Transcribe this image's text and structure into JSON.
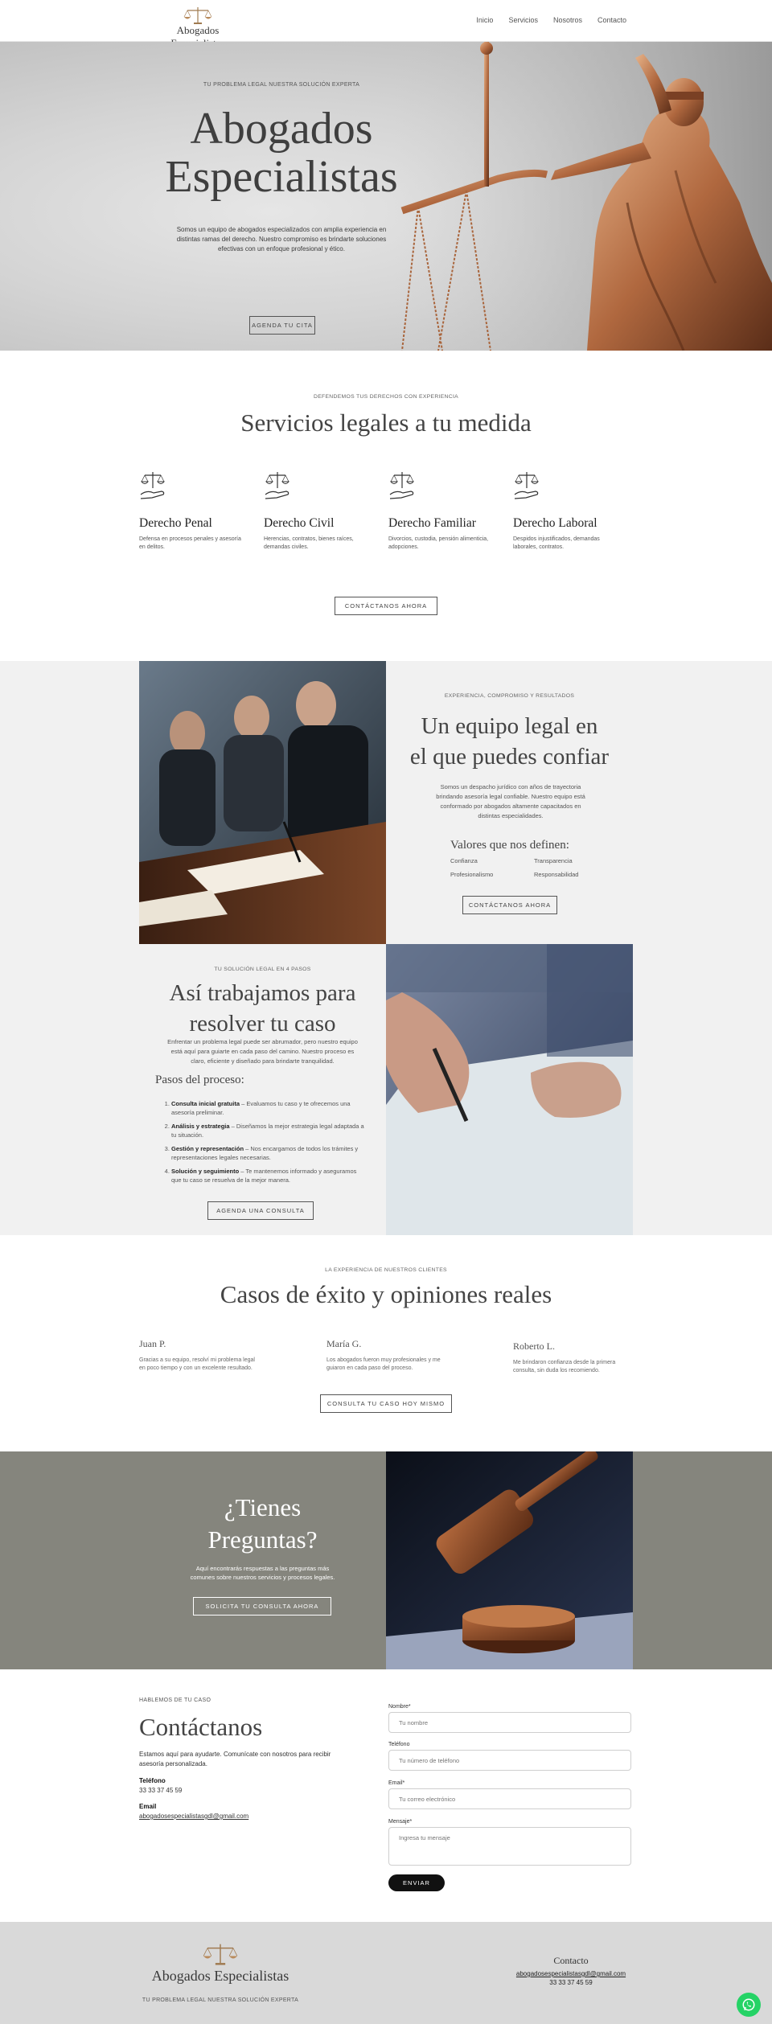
{
  "header": {
    "logo_text": "Abogados Especialistas",
    "nav": [
      "Inicio",
      "Servicios",
      "Nosotros",
      "Contacto"
    ]
  },
  "hero": {
    "kicker": "TU PROBLEMA LEGAL NUESTRA SOLUCIÓN EXPERTA",
    "title": "Abogados Especialistas",
    "description": "Somos un equipo de abogados especializados con amplia experiencia en distintas ramas del derecho. Nuestro compromiso es brindarte soluciones efectivas con un enfoque profesional y ético.",
    "cta": "AGENDA TU CITA"
  },
  "services": {
    "kicker": "DEFENDEMOS TUS DERECHOS CON EXPERIENCIA",
    "title": "Servicios legales a tu medida",
    "items": [
      {
        "title": "Derecho Penal",
        "desc": "Defensa en procesos penales y asesoría en delitos.",
        "icon": "scales-hand-icon"
      },
      {
        "title": "Derecho Civil",
        "desc": "Herencias, contratos, bienes raíces, demandas civiles.",
        "icon": "scales-hand-icon"
      },
      {
        "title": "Derecho Familiar",
        "desc": "Divorcios, custodia, pensión alimenticia, adopciones.",
        "icon": "scales-hand-icon"
      },
      {
        "title": "Derecho Laboral",
        "desc": "Despidos injustificados, demandas laborales, contratos.",
        "icon": "scales-hand-icon"
      }
    ],
    "cta": "CONTÁCTANOS AHORA"
  },
  "team": {
    "kicker": "EXPERIENCIA, COMPROMISO Y RESULTADOS",
    "title_line1": "Un equipo legal en",
    "title_line2": "el que puedes confiar",
    "description": "Somos un despacho jurídico con años de trayectoria brindando asesoría legal confiable. Nuestro equipo está conformado por abogados altamente capacitados en distintas especialidades.",
    "values_title": "Valores que nos definen:",
    "values": [
      "Confianza",
      "Transparencia",
      "Profesionalismo",
      "Responsabilidad"
    ],
    "cta": "CONTÁCTANOS AHORA"
  },
  "process": {
    "kicker": "TU SOLUCIÓN LEGAL EN 4 PASOS",
    "title_line1": "Así trabajamos para",
    "title_line2": "resolver tu caso",
    "description": "Enfrentar un problema legal puede ser abrumador, pero nuestro equipo está aquí para guiarte en cada paso del camino. Nuestro proceso es claro, eficiente y diseñado para brindarte tranquilidad.",
    "steps_title": "Pasos del proceso:",
    "steps": [
      {
        "bold": "Consulta inicial gratuita",
        "text": " – Evaluamos tu caso y te ofrecemos una asesoría preliminar."
      },
      {
        "bold": "Análisis y estrategia",
        "text": " – Diseñamos la mejor estrategia legal adaptada a tu situación."
      },
      {
        "bold": "Gestión y representación",
        "text": " – Nos encargamos de todos los trámites y representaciones legales necesarias."
      },
      {
        "bold": "Solución y seguimiento",
        "text": " – Te mantenemos informado y aseguramos que tu caso se resuelva de la mejor manera."
      }
    ],
    "cta": "AGENDA UNA CONSULTA"
  },
  "testimonials": {
    "kicker": "LA EXPERIENCIA DE NUESTROS CLIENTES",
    "title": "Casos de éxito y opiniones reales",
    "items": [
      {
        "name": "Juan P.",
        "text": "Gracias a su equipo, resolví mi problema legal en poco tiempo y con un excelente resultado."
      },
      {
        "name": "María G.",
        "text": "Los abogados fueron muy profesionales y me guiaron en cada paso del proceso."
      },
      {
        "name": "Roberto L.",
        "text": "Me brindaron confianza desde la primera consulta, sin duda los recomiendo."
      }
    ],
    "cta": "CONSULTA TU CASO HOY MISMO"
  },
  "faq": {
    "title_line1": "¿Tienes",
    "title_line2": "Preguntas?",
    "description": "Aquí encontrarás respuestas a las preguntas más comunes sobre nuestros servicios y procesos legales.",
    "cta": "SOLICITA TU CONSULTA AHORA"
  },
  "contact": {
    "kicker": "HABLEMOS DE TU CASO",
    "title": "Contáctanos",
    "description": "Estamos aquí para ayudarte. Comunícate con nosotros para recibir asesoría personalizada.",
    "phone_label": "Teléfono",
    "phone": "33 33 37 45 59",
    "email_label": "Email",
    "email": "abogadosespecialistasgdl@gmail.com",
    "form": {
      "name_label": "Nombre*",
      "name_placeholder": "Tu nombre",
      "phone_label": "Teléfono",
      "phone_placeholder": "Tu número de teléfono",
      "email_label": "Email*",
      "email_placeholder": "Tu correo electrónico",
      "message_label": "Mensaje*",
      "message_placeholder": "Ingresa tu mensaje",
      "submit": "ENVIAR"
    }
  },
  "footer": {
    "logo_text": "Abogados Especialistas",
    "tagline": "TU PROBLEMA LEGAL NUESTRA SOLUCIÓN EXPERTA",
    "contact_title": "Contacto",
    "email": "abogadosespecialistasgdl@gmail.com",
    "phone": "33 33 37 45 59"
  },
  "colors": {
    "faq_background": "#85857d",
    "section_grey": "#f1f1f1",
    "footer_background": "#d9d9d9",
    "whatsapp": "#25d366"
  }
}
